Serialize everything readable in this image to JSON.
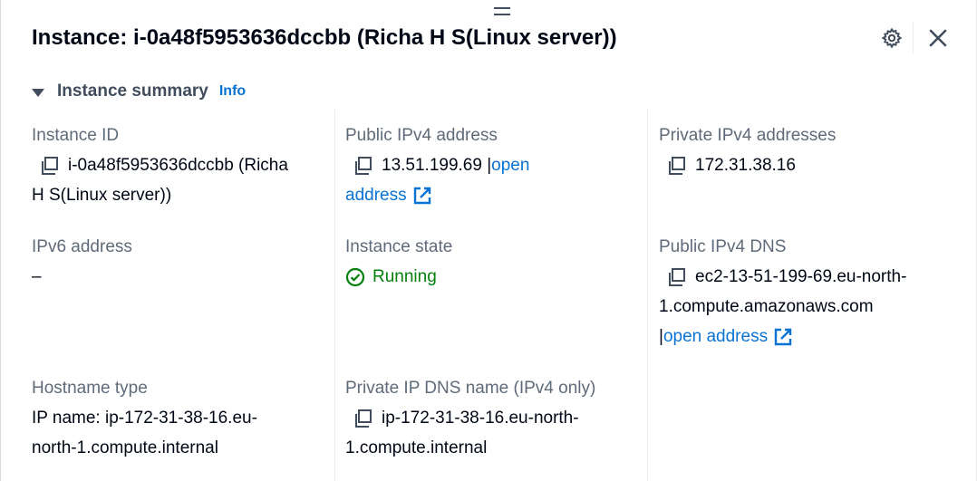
{
  "header": {
    "title": "Instance: i-0a48f5953636dccbb (Richa H S(Linux server))",
    "settings_icon": "gear-icon",
    "close_icon": "close-icon"
  },
  "summary": {
    "label": "Instance summary",
    "info": "Info"
  },
  "fields": {
    "instance_id": {
      "label": "Instance ID",
      "value_line1": "i-0a48f5953636dccbb (Richa",
      "value_line2": "H S(Linux server))"
    },
    "public_ipv4": {
      "label": "Public IPv4 address",
      "value": "13.51.199.69 |",
      "link_part1": "open",
      "link_part2": "address"
    },
    "private_ipv4": {
      "label": "Private IPv4 addresses",
      "value": "172.31.38.16"
    },
    "ipv6": {
      "label": "IPv6 address",
      "value": "–"
    },
    "instance_state": {
      "label": "Instance state",
      "value": "Running"
    },
    "public_dns": {
      "label": "Public IPv4 DNS",
      "value_line1": "ec2-13-51-199-69.eu-north-",
      "value_line2": "1.compute.amazonaws.com",
      "pipe": "|",
      "link": "open address"
    },
    "hostname_type": {
      "label": "Hostname type",
      "value_line1": "IP name: ip-172-31-38-16.eu-",
      "value_line2": "north-1.compute.internal"
    },
    "private_dns": {
      "label": "Private IP DNS name (IPv4 only)",
      "value_line1": "ip-172-31-38-16.eu-north-",
      "value_line2": "1.compute.internal"
    }
  },
  "colors": {
    "link": "#0972d3",
    "success": "#037f0c",
    "label": "#5f6b7a",
    "text": "#000716"
  }
}
